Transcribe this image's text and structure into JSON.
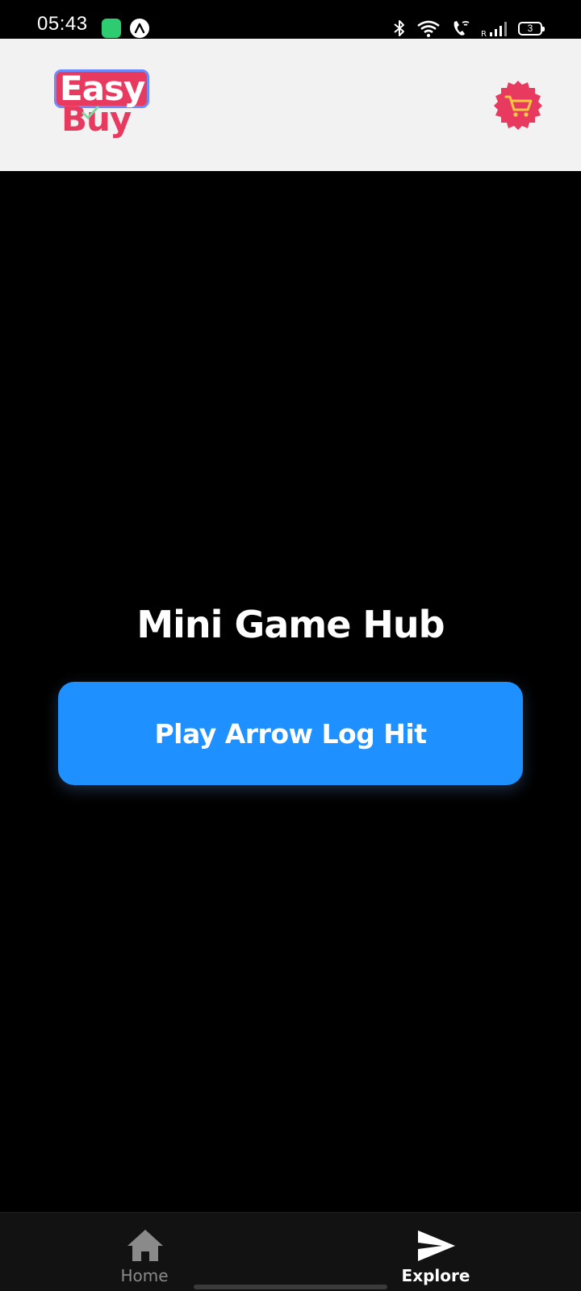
{
  "status_bar": {
    "time": "05:43",
    "battery": "3"
  },
  "header": {
    "logo": {
      "line1": "Easy",
      "line2": "Buy"
    },
    "cart_icon": "cart-icon"
  },
  "main": {
    "title": "Mini Game Hub",
    "play_button_label": "Play Arrow Log Hit"
  },
  "bottom_nav": {
    "items": [
      {
        "label": "Home",
        "icon": "home-icon",
        "active": false
      },
      {
        "label": "Explore",
        "icon": "send-icon",
        "active": true
      }
    ]
  },
  "colors": {
    "background": "#000000",
    "header_bg": "#f2f2f2",
    "brand_pink": "#e83a5f",
    "button_blue": "#1e90ff",
    "nav_bg": "#121212",
    "nav_inactive": "#8a8a8a",
    "nav_active": "#ffffff"
  }
}
